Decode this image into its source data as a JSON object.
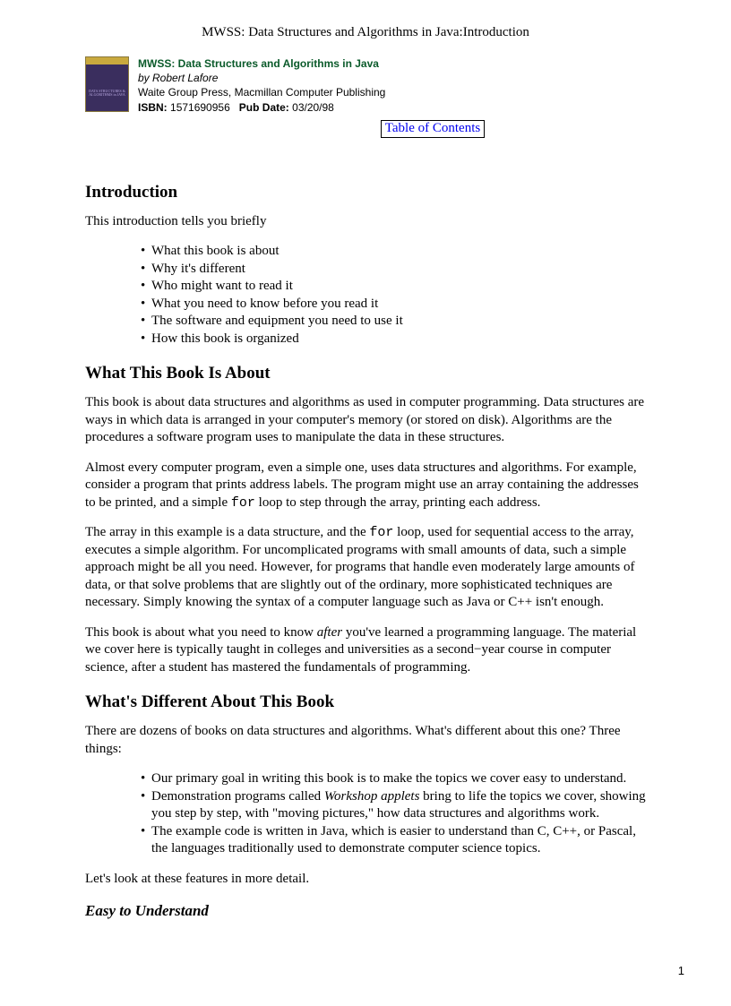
{
  "pageHeader": "MWSS: Data Structures and Algorithms in Java:Introduction",
  "book": {
    "title": "MWSS: Data Structures and Algorithms in Java",
    "author": "by Robert Lafore",
    "publisher": "Waite Group Press, Macmillan Computer Publishing",
    "isbnLabel": "ISBN:",
    "isbn": "1571690956",
    "pubDateLabel": "Pub Date:",
    "pubDate": "03/20/98",
    "coverText": "DATA STRUCTURES & ALGORITHMS in JAVA"
  },
  "tocLink": "Table of Contents",
  "sections": {
    "intro": {
      "heading": "Introduction",
      "lead": "This introduction tells you briefly",
      "bullets": [
        "What this book is about",
        "Why it's different",
        "Who might want to read it",
        "What you need to know before you read it",
        "The software and equipment you need to use it",
        "How this book is organized"
      ]
    },
    "about": {
      "heading": "What This Book Is About",
      "p1": "This book is about data structures and algorithms as used in computer programming. Data structures are ways in which data is arranged in your computer's memory (or stored on disk). Algorithms are the procedures a software program uses to manipulate the data in these structures.",
      "p2a": "Almost every computer program, even a simple one, uses data structures and algorithms. For example, consider a program that prints address labels. The program might use an array containing the addresses to be printed, and a simple ",
      "p2code": "for",
      "p2b": " loop to step through the array, printing each address.",
      "p3a": "The array in this example is a data structure, and the ",
      "p3code": "for",
      "p3b": " loop, used for sequential access to the array, executes a simple algorithm. For uncomplicated programs with small amounts of data, such a simple approach might be all you need. However, for programs that handle even moderately large amounts of data, or that solve problems that are slightly out of the ordinary, more sophisticated techniques are necessary. Simply knowing the syntax of a computer language such as Java or C++ isn't enough.",
      "p4a": "This book is about what you need to know ",
      "p4i": "after",
      "p4b": " you've learned a programming language. The material we cover here is typically taught in colleges and universities as a second−year course in computer science, after a student has mastered the fundamentals of programming."
    },
    "different": {
      "heading": "What's Different About This Book",
      "p1": "There are dozens of books on data structures and algorithms. What's different about this one? Three things:",
      "bullets": {
        "b1": "Our primary goal in writing this book is to make the topics we cover easy to understand.",
        "b2a": "Demonstration programs called ",
        "b2i": "Workshop applets",
        "b2b": " bring to life the topics we cover, showing you step by step, with \"moving pictures,\" how data structures and algorithms work.",
        "b3": "The example code is written in Java, which is easier to understand than C, C++, or Pascal, the languages traditionally used to demonstrate computer science topics."
      },
      "p2": "Let's look at these features in more detail."
    },
    "easy": {
      "heading": "Easy to Understand"
    }
  },
  "pageNumber": "1"
}
